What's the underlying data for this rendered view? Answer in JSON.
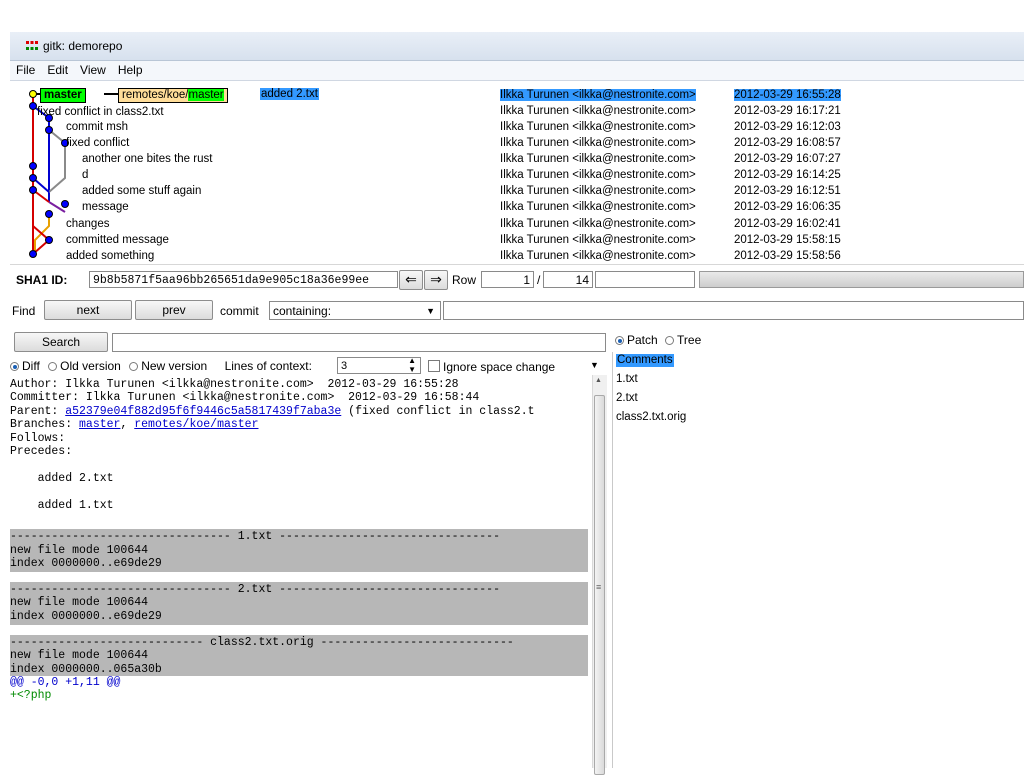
{
  "window": {
    "title": "gitk: demorepo"
  },
  "menu": [
    "File",
    "Edit",
    "View",
    "Help"
  ],
  "refs": {
    "head": "master",
    "remote_prefix": "remotes/koe/",
    "remote_branch": "master"
  },
  "commits": [
    {
      "subject": "added 2.txt",
      "author": "Ilkka Turunen <ilkka@nestronite.com>",
      "date": "2012-03-29 16:55:28"
    },
    {
      "subject": "fixed conflict in class2.txt",
      "author": "Ilkka Turunen <ilkka@nestronite.com>",
      "date": "2012-03-29 16:17:21"
    },
    {
      "subject": "commit msh",
      "author": "Ilkka Turunen <ilkka@nestronite.com>",
      "date": "2012-03-29 16:12:03"
    },
    {
      "subject": "fixed conflict",
      "author": "Ilkka Turunen <ilkka@nestronite.com>",
      "date": "2012-03-29 16:08:57"
    },
    {
      "subject": "another one bites the rust",
      "author": "Ilkka Turunen <ilkka@nestronite.com>",
      "date": "2012-03-29 16:07:27"
    },
    {
      "subject": "d",
      "author": "Ilkka Turunen <ilkka@nestronite.com>",
      "date": "2012-03-29 16:14:25"
    },
    {
      "subject": "added some stuff again",
      "author": "Ilkka Turunen <ilkka@nestronite.com>",
      "date": "2012-03-29 16:12:51"
    },
    {
      "subject": "message",
      "author": "Ilkka Turunen <ilkka@nestronite.com>",
      "date": "2012-03-29 16:06:35"
    },
    {
      "subject": "changes",
      "author": "Ilkka Turunen <ilkka@nestronite.com>",
      "date": "2012-03-29 16:02:41"
    },
    {
      "subject": "committed message",
      "author": "Ilkka Turunen <ilkka@nestronite.com>",
      "date": "2012-03-29 15:58:15"
    },
    {
      "subject": "added something",
      "author": "Ilkka Turunen <ilkka@nestronite.com>",
      "date": "2012-03-29 15:58:56"
    }
  ],
  "sha": {
    "label": "SHA1 ID:",
    "value": "9b8b5871f5aa96bb265651da9e905c18a36e99ee",
    "row_label": "Row",
    "row_current": "1",
    "row_sep": "/",
    "row_total": "14"
  },
  "find": {
    "label": "Find",
    "next": "next",
    "prev": "prev",
    "commit_label": "commit",
    "mode": "containing:"
  },
  "search": {
    "button": "Search"
  },
  "view_opts": {
    "diff": "Diff",
    "old": "Old version",
    "new": "New version",
    "context_label": "Lines of context:",
    "context_value": "3",
    "ignore_space": "Ignore space change"
  },
  "diff": {
    "author_line": "Author: Ilkka Turunen <ilkka@nestronite.com>  2012-03-29 16:55:28",
    "committer_line": "Committer: Ilkka Turunen <ilkka@nestronite.com>  2012-03-29 16:58:44",
    "parent_label": "Parent: ",
    "parent_sha": "a52379e04f882d95f6f9446c5a5817439f7aba3e",
    "parent_subject": " (fixed conflict in class2.t",
    "branches_label": "Branches: ",
    "branch_1": "master",
    "branch_sep": ", ",
    "branch_2": "remotes/koe/master",
    "follows": "Follows:",
    "precedes": "Precedes:",
    "msg_1": "    added 2.txt",
    "msg_2": "    added 1.txt",
    "file1_header": "-------------------------------- 1.txt --------------------------------",
    "file1_mode": "new file mode 100644",
    "file1_index": "index 0000000..e69de29",
    "file2_header": "-------------------------------- 2.txt --------------------------------",
    "file2_mode": "new file mode 100644",
    "file2_index": "index 0000000..e69de29",
    "file3_header": "---------------------------- class2.txt.orig ----------------------------",
    "file3_mode": "new file mode 100644",
    "file3_index": "index 0000000..065a30b",
    "hunk": "@@ -0,0 +1,11 @@",
    "add_line": "+<?php"
  },
  "files_panel": {
    "patch": "Patch",
    "tree": "Tree",
    "items": [
      "Comments",
      "1.txt",
      "2.txt",
      "class2.txt.orig"
    ]
  },
  "colors": {
    "head": "#00ff00",
    "remote": "#ffdd99",
    "selected": "#3399ff",
    "header_bg": "#b7b7b7"
  }
}
